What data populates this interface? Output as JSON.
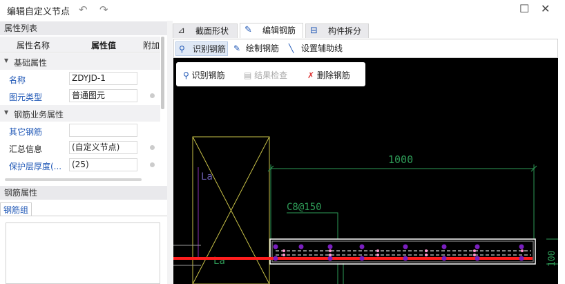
{
  "window": {
    "title": "编辑自定义节点",
    "undo_icon": "undo-icon",
    "redo_icon": "redo-icon"
  },
  "property_panel": {
    "header": "属性列表",
    "columns": [
      "属性名称",
      "属性值",
      "附加"
    ],
    "groups": [
      {
        "label": "基础属性"
      },
      {
        "label": "钢筋业务属性"
      }
    ],
    "rows": [
      {
        "name": "名称",
        "value": "ZDYJD-1"
      },
      {
        "name": "图元类型",
        "value": "普通图元"
      },
      {
        "name": "其它钢筋",
        "value": ""
      },
      {
        "name": "汇总信息",
        "value": "(自定义节点)"
      },
      {
        "name": "保护层厚度(...",
        "value": "(25)"
      }
    ]
  },
  "rebar_panel": {
    "header": "钢筋属性",
    "tab": "钢筋组"
  },
  "tabs": [
    {
      "label": "截面形状",
      "icon": "section-shape-icon"
    },
    {
      "label": "编辑钢筋",
      "icon": "edit-rebar-icon"
    },
    {
      "label": "构件拆分",
      "icon": "component-split-icon"
    }
  ],
  "subtoolbar": {
    "items": [
      "识别钢筋",
      "绘制钢筋",
      "设置辅助线"
    ]
  },
  "popup": {
    "items": [
      "识别钢筋",
      "结果检查",
      "删除钢筋"
    ]
  },
  "canvas": {
    "dimension_label": "1000",
    "rebar_label": "C8@150",
    "la_top": "La",
    "la_bottom": "La",
    "right_dim": "100"
  }
}
